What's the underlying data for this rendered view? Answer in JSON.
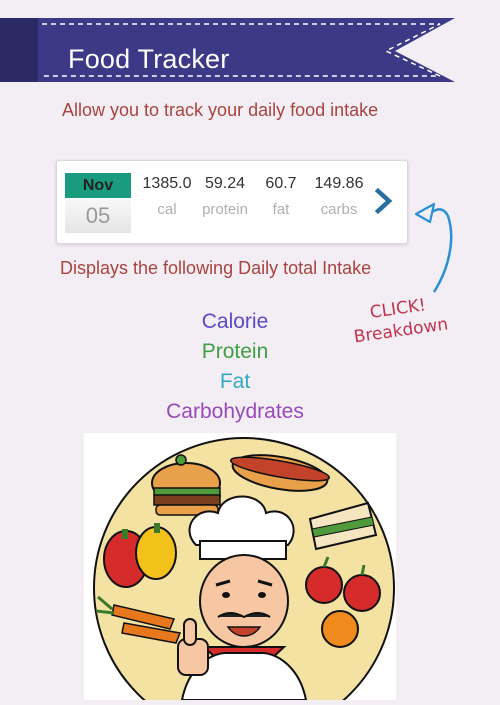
{
  "header": {
    "title": "Food Tracker"
  },
  "tagline": "Allow you to track  your  daily food intake",
  "summary_card": {
    "date": {
      "month": "Nov",
      "day": "05"
    },
    "stats": [
      {
        "value": "1385.0",
        "label": "cal"
      },
      {
        "value": "59.24",
        "label": "protein"
      },
      {
        "value": "60.7",
        "label": "fat"
      },
      {
        "value": "149.86",
        "label": "carbs"
      }
    ],
    "next_icon": "chevron-right-icon"
  },
  "description": "Displays  the following Daily total Intake",
  "annotation": {
    "line1": "CLICK!",
    "line2": "Breakdown"
  },
  "nutrients": [
    "Calorie",
    "Protein",
    "Fat",
    "Carbohydrates"
  ],
  "colors": {
    "banner": "#3c3a86",
    "accent_text": "#a8443f",
    "month_bg": "#1a9a7e",
    "chevron": "#2a6fa0",
    "calorie": "#5a4bc8",
    "protein": "#3d9e45",
    "fat": "#32a8c4",
    "carbs": "#9a4ab8"
  }
}
